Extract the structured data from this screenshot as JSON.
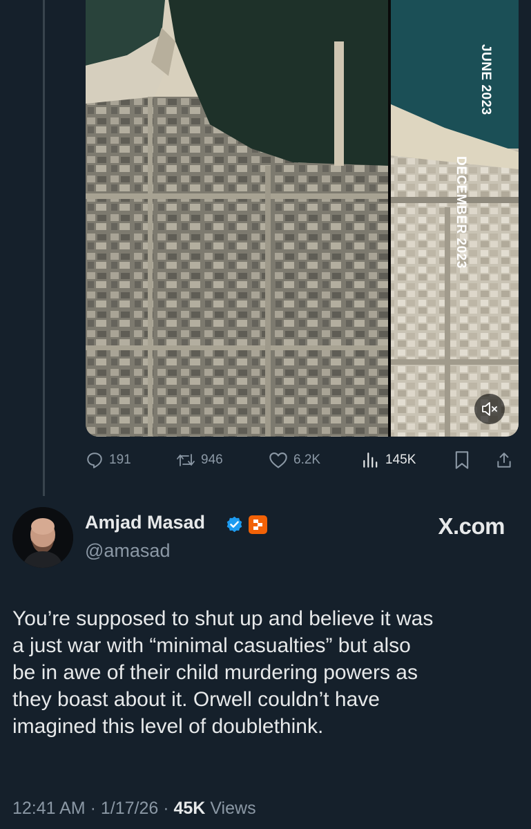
{
  "media": {
    "label_right": "JUNE 2023",
    "label_left": "DECEMBER 2023",
    "mute_icon": "speaker-muted-icon"
  },
  "actions": {
    "replies": "191",
    "reposts": "946",
    "likes": "6.2K",
    "views": "145K"
  },
  "author": {
    "name": "Amjad Masad",
    "handle": "@amasad",
    "verified_color": "#1d9bf0",
    "affiliation_color": "#f26207"
  },
  "watermark": "X.com",
  "tweet": {
    "lines": [
      "You’re supposed to shut up and believe it was",
      "a just war with “minimal casualties” but also",
      "be in awe of their child murdering powers as",
      "they boast about it. Orwell couldn’t have",
      "imagined this level of doublethink."
    ]
  },
  "meta": {
    "time": "12:41 AM",
    "date": "1/17/26",
    "views_count": "45K",
    "views_label": "Views"
  },
  "colors": {
    "background": "#15202b",
    "muted_text": "#8b98a5",
    "text": "#e7e9ea"
  }
}
